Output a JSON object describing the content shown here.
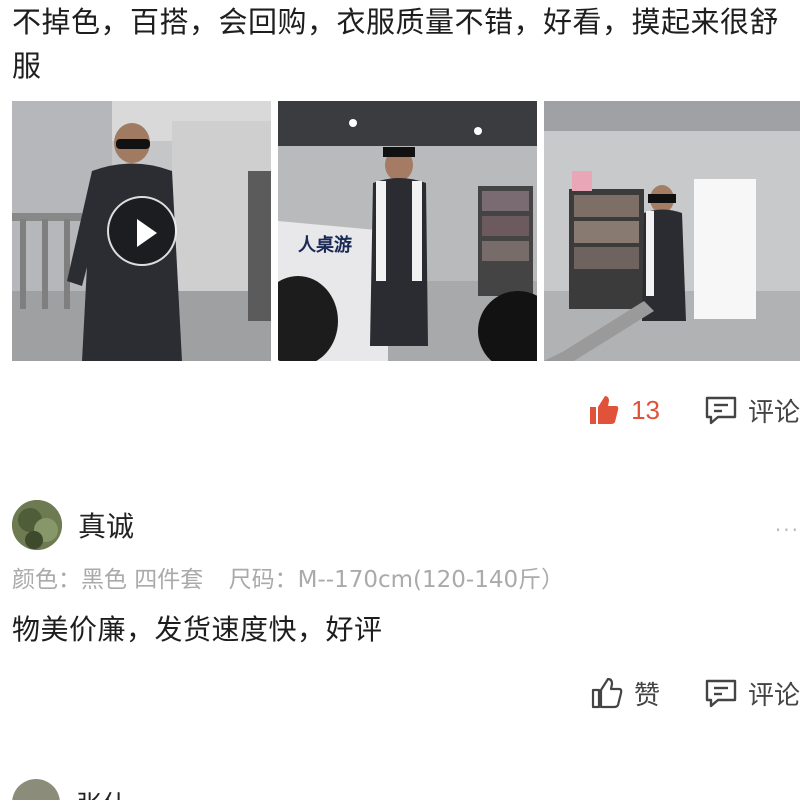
{
  "review1": {
    "text": "不掉色，百搭，会回购，衣服质量不错，好看，摸起来很舒服",
    "photos": [
      {
        "icon": "video-thumbnail",
        "has_play": true
      },
      {
        "icon": "photo-thumbnail"
      },
      {
        "icon": "photo-thumbnail"
      }
    ],
    "photo2_sign": "人桌游",
    "like_count": "13",
    "comment_label": "评论"
  },
  "review2": {
    "username": "真诚",
    "more": "···",
    "spec": {
      "color": "颜色：黑色 四件套",
      "size": "尺码：M--170cm(120-140斤）"
    },
    "text": "物美价廉，发货速度快，好评",
    "like_label": "赞",
    "comment_label": "评论"
  },
  "review3": {
    "username": "张仕"
  },
  "colors": {
    "like_active": "#e0533a",
    "secondary_text": "#aaaaaa"
  }
}
